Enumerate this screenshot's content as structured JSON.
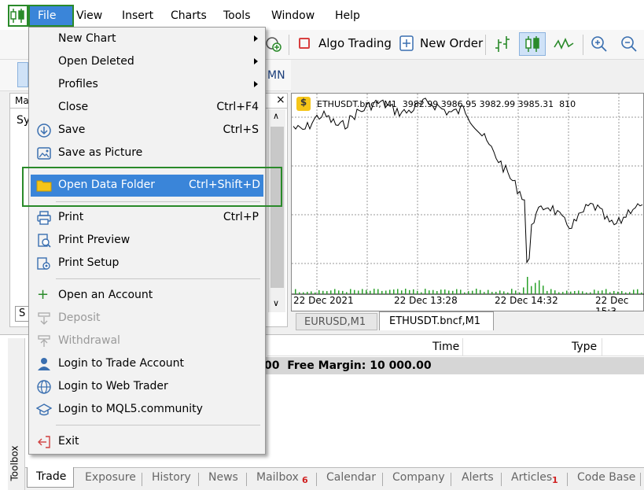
{
  "menubar": {
    "file": "File",
    "items": [
      "View",
      "Insert",
      "Charts",
      "Tools",
      "Window",
      "Help"
    ]
  },
  "toolbar": {
    "algo_trading": "Algo Trading",
    "new_order": "New Order",
    "timeframe_mn": "MN"
  },
  "market_watch": {
    "title_partial": "Ma",
    "col_partial": "Sy",
    "tab_partial": "S"
  },
  "file_menu": {
    "items": [
      {
        "label": "New Chart",
        "shortcut": "",
        "submenu": true
      },
      {
        "label": "Open Deleted",
        "shortcut": "",
        "submenu": true
      },
      {
        "label": "Profiles",
        "shortcut": "",
        "submenu": true
      },
      {
        "label": "Close",
        "shortcut": "Ctrl+F4"
      },
      {
        "label": "Save",
        "shortcut": "Ctrl+S"
      },
      {
        "label": "Save as Picture",
        "shortcut": ""
      },
      {
        "label": "Open Data Folder",
        "shortcut": "Ctrl+Shift+D"
      },
      {
        "label": "Print",
        "shortcut": "Ctrl+P"
      },
      {
        "label": "Print Preview",
        "shortcut": ""
      },
      {
        "label": "Print Setup",
        "shortcut": ""
      },
      {
        "label": "Open an Account",
        "shortcut": ""
      },
      {
        "label": "Deposit",
        "shortcut": "",
        "disabled": true
      },
      {
        "label": "Withdrawal",
        "shortcut": "",
        "disabled": true
      },
      {
        "label": "Login to Trade Account",
        "shortcut": ""
      },
      {
        "label": "Login to Web Trader",
        "shortcut": ""
      },
      {
        "label": "Login to MQL5.community",
        "shortcut": ""
      },
      {
        "label": "Exit",
        "shortcut": ""
      }
    ]
  },
  "chart": {
    "header": "ETHUSDT.bncf, M1  3982.99 3986.95 3982.99 3985.31  810",
    "time_labels": [
      "22 Dec 2021",
      "22 Dec 13:28",
      "22 Dec 14:32",
      "22 Dec 15:3"
    ],
    "tabs": [
      "EURUSD,M1",
      "ETHUSDT.bncf,M1"
    ],
    "active_tab": "ETHUSDT.bncf,M1"
  },
  "toolbox": {
    "side_label": "Toolbox",
    "columns": [
      "Time",
      "Type"
    ],
    "balance_text": "00  Free Margin: 10 000.00",
    "tabs": [
      {
        "label": "Trade",
        "badge": ""
      },
      {
        "label": "Exposure",
        "badge": ""
      },
      {
        "label": "History",
        "badge": ""
      },
      {
        "label": "News",
        "badge": ""
      },
      {
        "label": "Mailbox",
        "badge": "6"
      },
      {
        "label": "Calendar",
        "badge": ""
      },
      {
        "label": "Company",
        "badge": ""
      },
      {
        "label": "Alerts",
        "badge": ""
      },
      {
        "label": "Articles",
        "badge": "1"
      },
      {
        "label": "Code Base",
        "badge": ""
      }
    ]
  },
  "colors": {
    "highlight": "#3a85d9",
    "outline": "#2a8a2a",
    "badge": "#d02020",
    "bull": "#2aa12a"
  }
}
